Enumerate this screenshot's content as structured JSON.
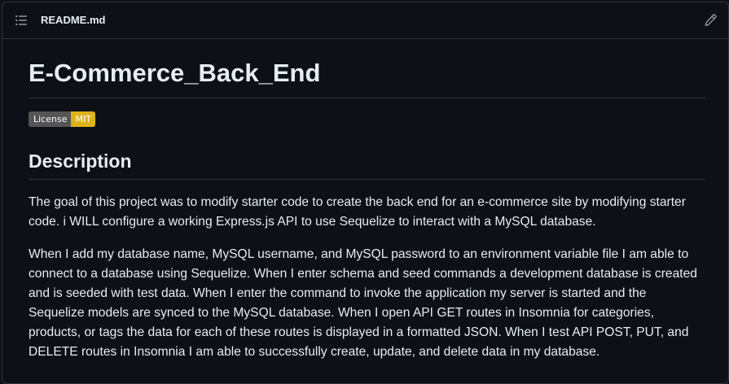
{
  "header": {
    "filename": "README.md",
    "outline_icon": "list-unordered-icon",
    "edit_icon": "pencil-icon"
  },
  "readme": {
    "title": "E-Commerce_Back_End",
    "badge": {
      "label": "License",
      "value": "MIT",
      "value_color": "#dfb317"
    },
    "description_heading": "Description",
    "paragraphs": [
      "The goal of this project was to modify starter code to create the back end for an e-commerce site by modifying starter code. i WILL configure a working Express.js API to use Sequelize to interact with a MySQL database.",
      "When I add my database name, MySQL username, and MySQL password to an environment variable file I am able to connect to a database using Sequelize. When I enter schema and seed commands a development database is created and is seeded with test data. When I enter the command to invoke the application my server is started and the Sequelize models are synced to the MySQL database. When I open API GET routes in Insomnia for categories, products, or tags the data for each of these routes is displayed in a formatted JSON. When I test API POST, PUT, and DELETE routes in Insomnia I am able to successfully create, update, and delete data in my database."
    ]
  },
  "colors": {
    "background": "#0d1117",
    "text": "#e6edf3",
    "border": "#30363d",
    "icon": "#9198a1"
  }
}
